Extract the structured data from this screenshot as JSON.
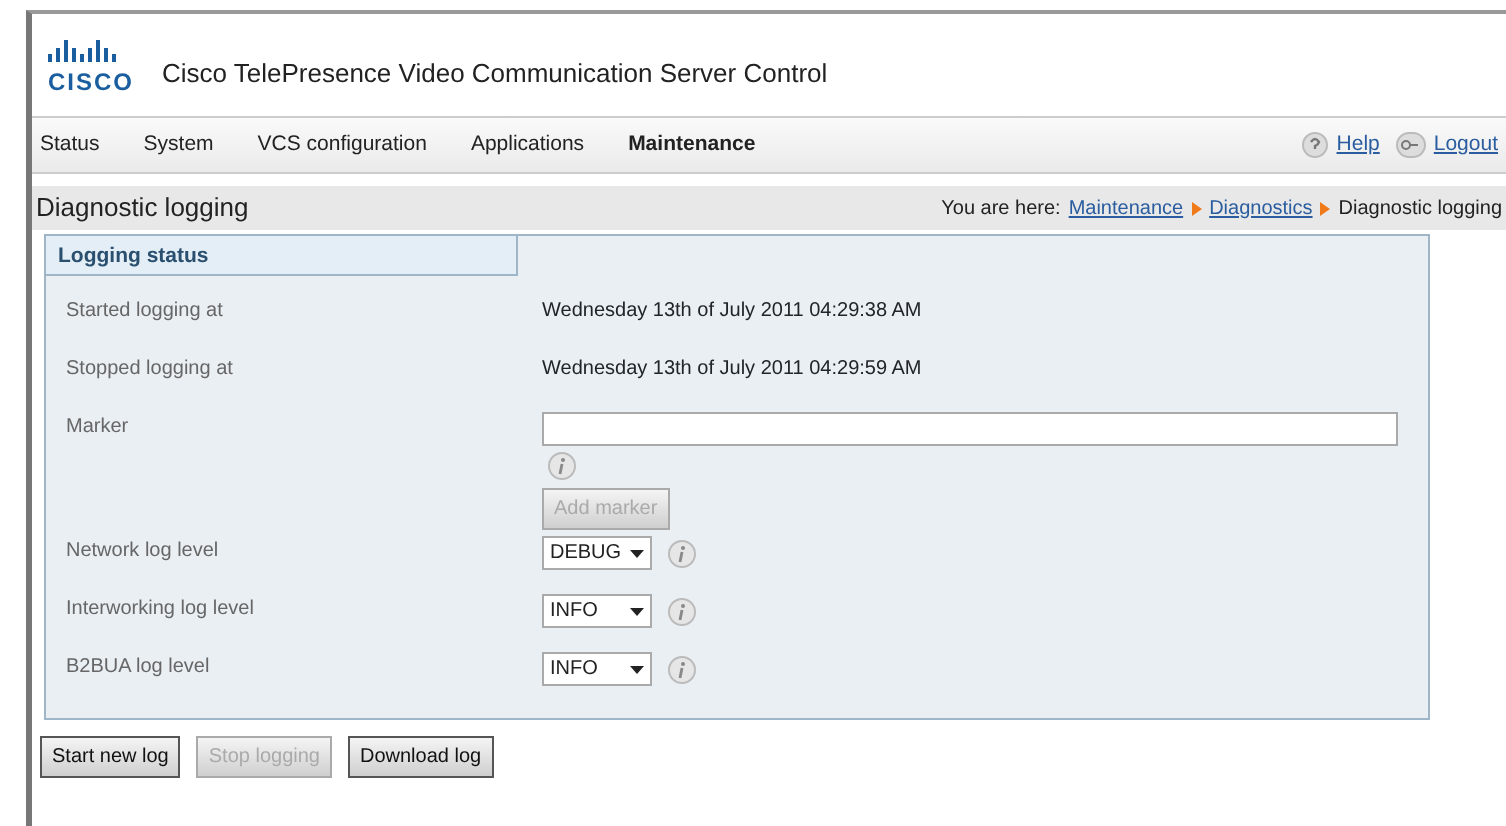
{
  "header": {
    "logo_text": "CISCO",
    "title": "Cisco TelePresence Video Communication Server Control"
  },
  "nav": {
    "items": [
      {
        "label": "Status",
        "selected": false
      },
      {
        "label": "System",
        "selected": false
      },
      {
        "label": "VCS configuration",
        "selected": false
      },
      {
        "label": "Applications",
        "selected": false
      },
      {
        "label": "Maintenance",
        "selected": true
      }
    ],
    "help": "Help",
    "logout": "Logout"
  },
  "page": {
    "title": "Diagnostic logging",
    "breadcrumb_label": "You are here:",
    "breadcrumb": [
      {
        "label": "Maintenance",
        "link": true
      },
      {
        "label": "Diagnostics",
        "link": true
      },
      {
        "label": "Diagnostic logging",
        "link": false
      }
    ]
  },
  "panel": {
    "title": "Logging status",
    "rows": [
      {
        "kind": "text",
        "label": "Started logging at",
        "value": "Wednesday 13th of July 2011 04:29:38 AM"
      },
      {
        "kind": "text",
        "label": "Stopped logging at",
        "value": "Wednesday 13th of July 2011 04:29:59 AM"
      },
      {
        "kind": "marker",
        "label": "Marker",
        "button": {
          "label": "Add marker",
          "disabled": true
        }
      },
      {
        "kind": "select",
        "label": "Network log level",
        "value": "DEBUG"
      },
      {
        "kind": "select",
        "label": "Interworking log level",
        "value": "INFO"
      },
      {
        "kind": "select",
        "label": "B2BUA log level",
        "value": "INFO"
      }
    ]
  },
  "buttons": [
    {
      "label": "Start new log",
      "disabled": false
    },
    {
      "label": "Stop logging",
      "disabled": true
    },
    {
      "label": "Download log",
      "disabled": false
    }
  ]
}
